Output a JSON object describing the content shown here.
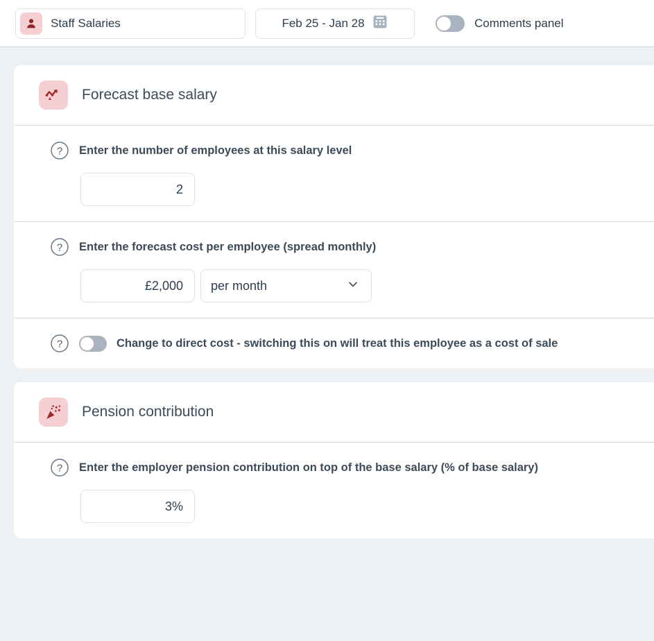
{
  "topbar": {
    "entity": {
      "icon": "user-icon",
      "label": "Staff Salaries"
    },
    "date_range": {
      "label": "Feb 25 - Jan 28",
      "icon": "calendar-icon"
    },
    "comments_toggle": {
      "label": "Comments panel",
      "state": "off"
    }
  },
  "colors": {
    "page_background": "#eef1f4",
    "card_background": "#ffffff",
    "accent_icon_background": "#f6cfd2",
    "accent_icon_foreground": "#9e2b2b",
    "text_primary": "#3d4a58",
    "text_secondary": "#2e3d4d",
    "border": "#dde1e6",
    "divider": "#d6d9dd",
    "toggle_track_off": "#aab4c0"
  },
  "cards": [
    {
      "icon": "trend-up-icon",
      "title": "Forecast base salary",
      "fields": [
        {
          "type": "number",
          "help_icon": "question-circle-icon",
          "label": "Enter the number of employees at this salary level",
          "value": "2"
        },
        {
          "type": "amount-with-select",
          "help_icon": "question-circle-icon",
          "label": "Enter the forecast cost per employee (spread monthly)",
          "value": "£2,000",
          "select_value": "per month",
          "select_icon": "chevron-down-icon"
        },
        {
          "type": "toggle",
          "help_icon": "question-circle-icon",
          "label": "Change to direct cost - switching this on will treat this employee as a cost of sale",
          "state": "off"
        }
      ]
    },
    {
      "icon": "party-popper-icon",
      "title": "Pension contribution",
      "fields": [
        {
          "type": "number",
          "help_icon": "question-circle-icon",
          "label": "Enter the employer pension contribution on top of the base salary (% of base salary)",
          "value": "3%"
        }
      ]
    }
  ]
}
